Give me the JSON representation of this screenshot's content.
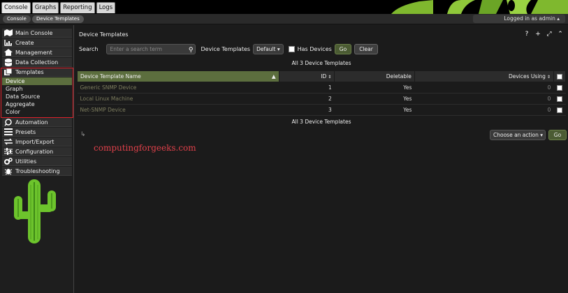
{
  "tabs": [
    "Console",
    "Graphs",
    "Reporting",
    "Logs"
  ],
  "breadcrumb": [
    "Console",
    "Device Templates"
  ],
  "login_status": "Logged in as admin ▴",
  "sidebar": {
    "items": [
      {
        "label": "Main Console",
        "icon": "map-icon"
      },
      {
        "label": "Create",
        "icon": "chart-icon"
      },
      {
        "label": "Management",
        "icon": "home-icon"
      },
      {
        "label": "Data Collection",
        "icon": "database-icon"
      },
      {
        "label": "Templates",
        "icon": "copy-icon"
      }
    ],
    "templates_sub": [
      "Device",
      "Graph",
      "Data Source",
      "Aggregate",
      "Color"
    ],
    "items_after": [
      {
        "label": "Automation",
        "icon": "search-icon"
      },
      {
        "label": "Presets",
        "icon": "presets-icon"
      },
      {
        "label": "Import/Export",
        "icon": "transfer-icon"
      },
      {
        "label": "Configuration",
        "icon": "sliders-icon"
      },
      {
        "label": "Utilities",
        "icon": "gears-icon"
      },
      {
        "label": "Troubleshooting",
        "icon": "bug-icon"
      }
    ]
  },
  "page": {
    "title": "Device Templates",
    "search_label": "Search",
    "search_placeholder": "Enter a search term",
    "filter_label": "Device Templates",
    "filter_value": "Default",
    "has_devices_label": "Has Devices",
    "go_label": "Go",
    "clear_label": "Clear",
    "count_text": "All 3 Device Templates"
  },
  "table": {
    "headers": [
      "Device Template Name",
      "ID",
      "Deletable",
      "Devices Using"
    ],
    "rows": [
      {
        "name": "Generic SNMP Device",
        "id": "1",
        "deletable": "Yes",
        "devices": "0"
      },
      {
        "name": "Local Linux Machine",
        "id": "2",
        "deletable": "Yes",
        "devices": "0"
      },
      {
        "name": "Net-SNMP Device",
        "id": "3",
        "deletable": "Yes",
        "devices": "0"
      }
    ]
  },
  "actions": {
    "select_label": "Choose an action",
    "go_label": "Go"
  },
  "watermark": "computingforgeeks.com",
  "colors": {
    "accent": "#5c6e3e",
    "highlight_box": "#e0202a",
    "watermark": "#e0404a"
  }
}
